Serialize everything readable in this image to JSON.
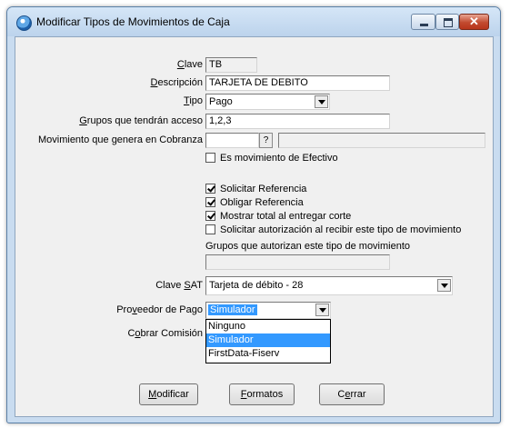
{
  "window": {
    "title": "Modificar Tipos de Movimientos de Caja"
  },
  "form": {
    "clave": {
      "label": "Clave",
      "value": "TB"
    },
    "descripcion": {
      "label": "Descripción",
      "value": "TARJETA DE DEBITO"
    },
    "tipo": {
      "label": "Tipo",
      "value": "Pago"
    },
    "grupos_acceso": {
      "label": "Grupos que tendrán acceso",
      "value": "1,2,3"
    },
    "movimiento_cobranza": {
      "label": "Movimiento que genera en Cobranza",
      "value": "",
      "lookup_label": "?",
      "description": ""
    },
    "checkboxes": [
      {
        "label": "Es movimiento de Efectivo",
        "checked": false
      },
      {
        "label": "Solicitar Referencia",
        "checked": true
      },
      {
        "label": "Obligar Referencia",
        "checked": true
      },
      {
        "label": "Mostrar total al entregar corte",
        "checked": true
      },
      {
        "label": "Solicitar autorización al recibir este tipo de movimiento",
        "checked": false
      }
    ],
    "grupos_autorizan": {
      "label": "Grupos que autorizan este tipo de movimiento",
      "value": ""
    },
    "clave_sat": {
      "label": "Clave SAT",
      "value": "Tarjeta de débito - 28"
    },
    "proveedor_pago": {
      "label": "Proveedor de Pago",
      "value": "Simulador",
      "options": [
        "Ninguno",
        "Simulador",
        "FirstData-Fiserv"
      ],
      "selected_index": 1
    },
    "cobrar_comision": {
      "label": "Cobrar Comisión"
    }
  },
  "buttons": {
    "modificar": "Modificar",
    "formatos": "Formatos",
    "cerrar": "Cerrar"
  },
  "colors": {
    "title_bar": "#c9dcf0",
    "dialog_bg": "#f0f0f0",
    "selection": "#3399ff",
    "close_button": "#c24a2f"
  }
}
